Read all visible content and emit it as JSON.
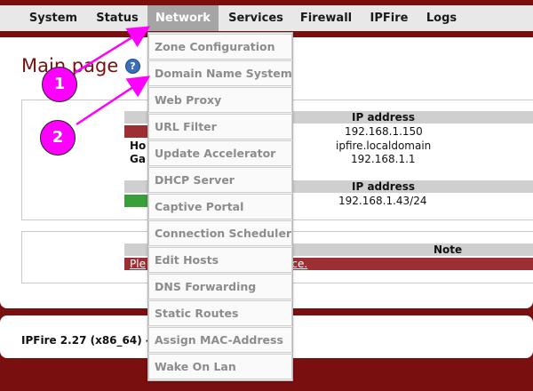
{
  "nav": {
    "items": [
      {
        "label": "System"
      },
      {
        "label": "Status"
      },
      {
        "label": "Network"
      },
      {
        "label": "Services"
      },
      {
        "label": "Firewall"
      },
      {
        "label": "IPFire"
      },
      {
        "label": "Logs"
      }
    ],
    "active": "Network"
  },
  "page": {
    "title": "Main page",
    "help_icon": "?"
  },
  "panel1": {
    "header": "IP address",
    "values": [
      "192.168.1.150",
      "ipfire.localdomain",
      "192.168.1.1"
    ],
    "left_labels": [
      "Ho",
      "Ga"
    ]
  },
  "panel2": {
    "header": "IP address",
    "value": "192.168.1.43/24"
  },
  "panel3": {
    "header": "Note",
    "link_left": "Ple",
    "link_right": "vice."
  },
  "footer": {
    "text": "IPFire 2.27 (x86_64) -"
  },
  "dropdown": {
    "items": [
      "Zone Configuration",
      "Domain Name System",
      "Web Proxy",
      "URL Filter",
      "Update Accelerator",
      "DHCP Server",
      "Captive Portal",
      "Connection Scheduler",
      "Edit Hosts",
      "DNS Forwarding",
      "Static Routes",
      "Assign MAC-Address",
      "Wake On Lan"
    ]
  },
  "annotations": {
    "badge1": "1",
    "badge2": "2",
    "color": "#ff00ff"
  }
}
